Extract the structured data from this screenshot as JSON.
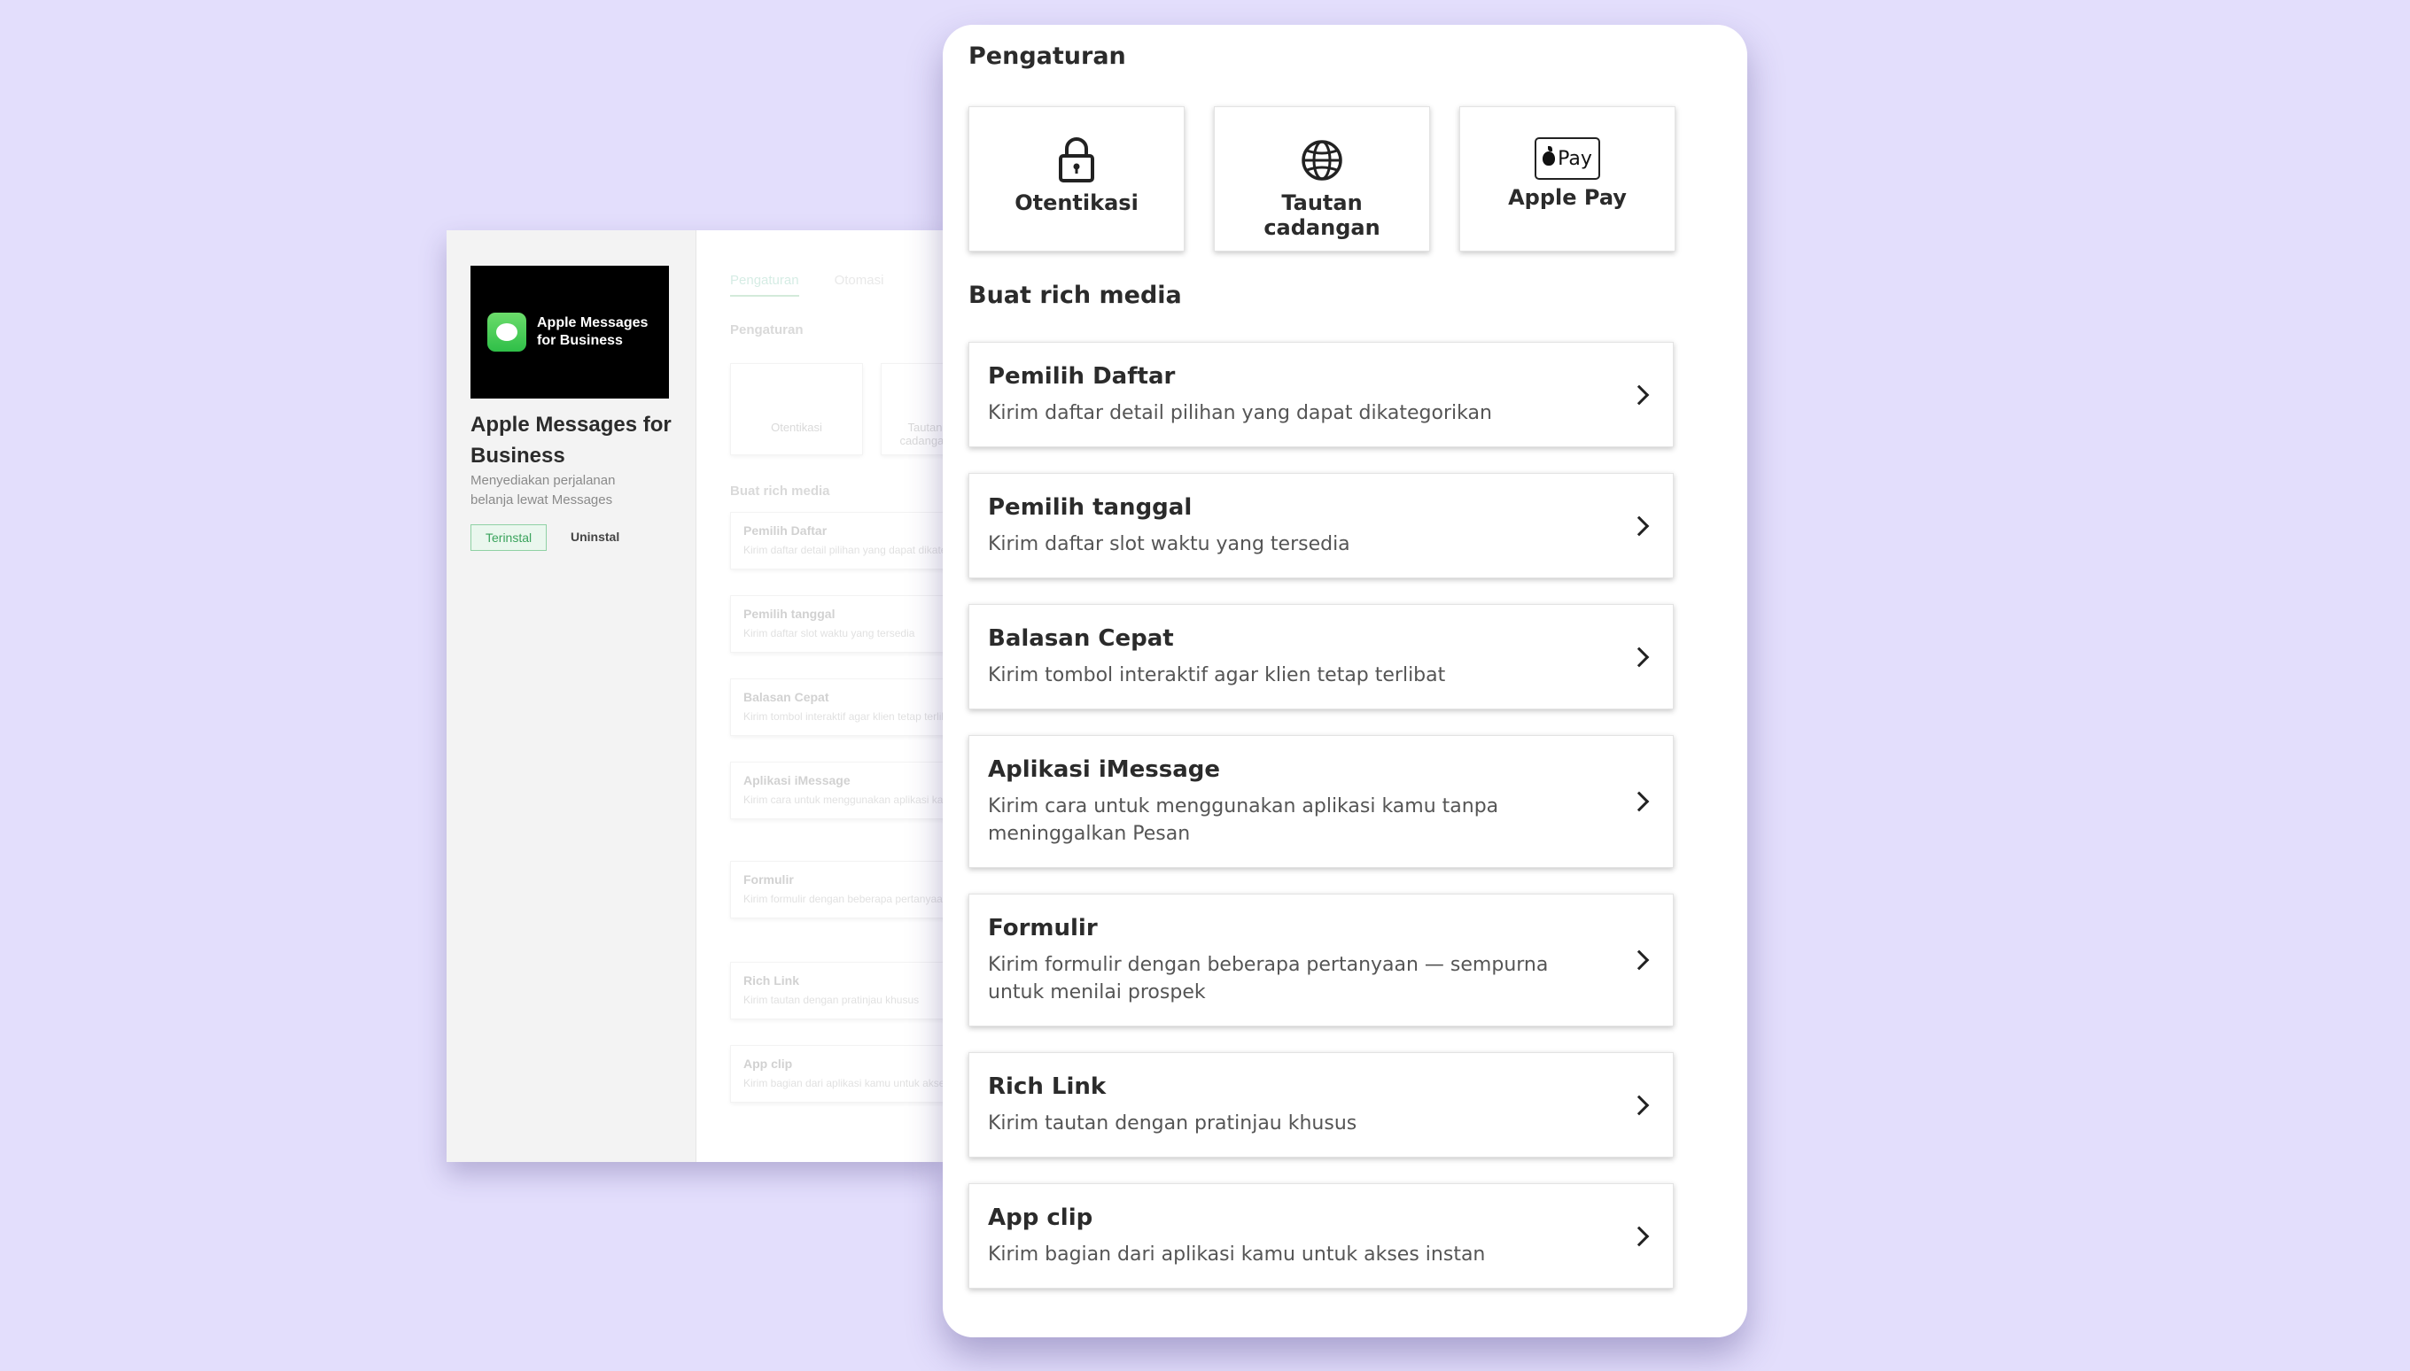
{
  "colors": {
    "background": "#e3defc",
    "panel": "#ffffff",
    "installed_green": "#3aa35c"
  },
  "background_window": {
    "logo_text": "Apple Messages for Business",
    "app_title": "Apple Messages for Business",
    "app_description": "Menyediakan perjalanan belanja lewat Messages",
    "installed_badge": "Terinstal",
    "uninstall_label": "Uninstal",
    "tabs": [
      "Pengaturan",
      "Otomasi"
    ],
    "section_settings": "Pengaturan",
    "cards": [
      "Otentikasi",
      "Tautan cadangan"
    ],
    "section_rich": "Buat rich media",
    "items": [
      {
        "title": "Pemilih Daftar",
        "desc": "Kirim daftar detail pilihan yang dapat dikategorikan"
      },
      {
        "title": "Pemilih tanggal",
        "desc": "Kirim daftar slot waktu yang tersedia"
      },
      {
        "title": "Balasan Cepat",
        "desc": "Kirim tombol interaktif agar klien tetap terlibat"
      },
      {
        "title": "Aplikasi iMessage",
        "desc": "Kirim cara untuk menggunakan aplikasi kamu tanpa meninggalkan Pesan"
      },
      {
        "title": "Formulir",
        "desc": "Kirim formulir dengan beberapa pertanyaan — sempurna untuk menilai prospek"
      },
      {
        "title": "Rich Link",
        "desc": "Kirim tautan dengan pratinjau khusus"
      },
      {
        "title": "App clip",
        "desc": "Kirim bagian dari aplikasi kamu untuk akses instan"
      }
    ]
  },
  "panel": {
    "title": "Pengaturan",
    "settings_cards": [
      {
        "label": "Otentikasi",
        "icon": "lock-icon"
      },
      {
        "label": "Tautan cadangan",
        "icon": "globe-icon"
      },
      {
        "label": "Apple Pay",
        "icon": "apple-pay-icon",
        "icon_text": "Pay"
      }
    ],
    "section_rich": "Buat rich media",
    "rich_items": [
      {
        "title": "Pemilih Daftar",
        "desc": "Kirim daftar detail pilihan yang dapat dikategorikan"
      },
      {
        "title": "Pemilih tanggal",
        "desc": "Kirim daftar slot waktu yang tersedia"
      },
      {
        "title": "Balasan Cepat",
        "desc": "Kirim tombol interaktif agar klien tetap terlibat"
      },
      {
        "title": "Aplikasi iMessage",
        "desc": "Kirim cara untuk menggunakan aplikasi kamu tanpa meninggalkan Pesan"
      },
      {
        "title": "Formulir",
        "desc": "Kirim formulir dengan beberapa pertanyaan — sempurna untuk menilai prospek"
      },
      {
        "title": "Rich Link",
        "desc": "Kirim tautan dengan pratinjau khusus"
      },
      {
        "title": "App clip",
        "desc": "Kirim bagian dari aplikasi kamu untuk akses instan"
      }
    ]
  }
}
